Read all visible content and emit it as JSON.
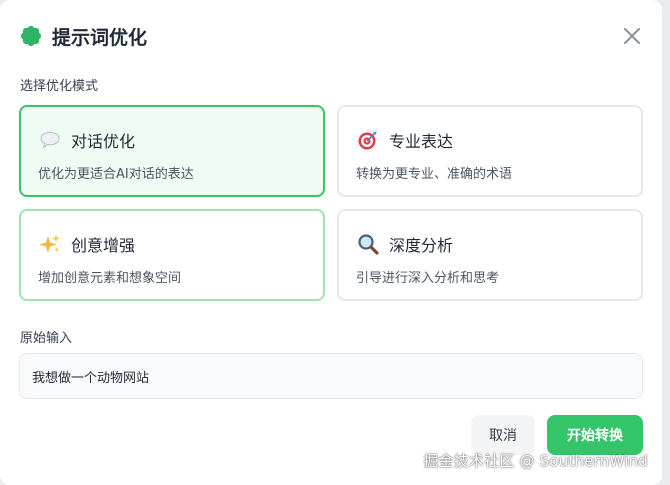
{
  "dialog": {
    "title": "提示词优化",
    "close_icon": "close-icon",
    "logo_icon": "gear-flower-icon",
    "accent_color": "#34c46a"
  },
  "modes": {
    "label": "选择优化模式",
    "items": [
      {
        "icon": "speech-bubble-icon",
        "title": "对话优化",
        "desc": "优化为更适合AI对话的表达",
        "state": "selected"
      },
      {
        "icon": "target-icon",
        "title": "专业表达",
        "desc": "转换为更专业、准确的术语",
        "state": "default"
      },
      {
        "icon": "sparkles-icon",
        "title": "创意增强",
        "desc": "增加创意元素和想象空间",
        "state": "hovered"
      },
      {
        "icon": "magnifier-icon",
        "title": "深度分析",
        "desc": "引导进行深入分析和思考",
        "state": "default"
      }
    ]
  },
  "input": {
    "label": "原始输入",
    "value": "我想做一个动物网站"
  },
  "actions": {
    "cancel_label": "取消",
    "submit_label": "开始转换"
  },
  "watermark": "掘金技术社区 @ SouthernWind"
}
